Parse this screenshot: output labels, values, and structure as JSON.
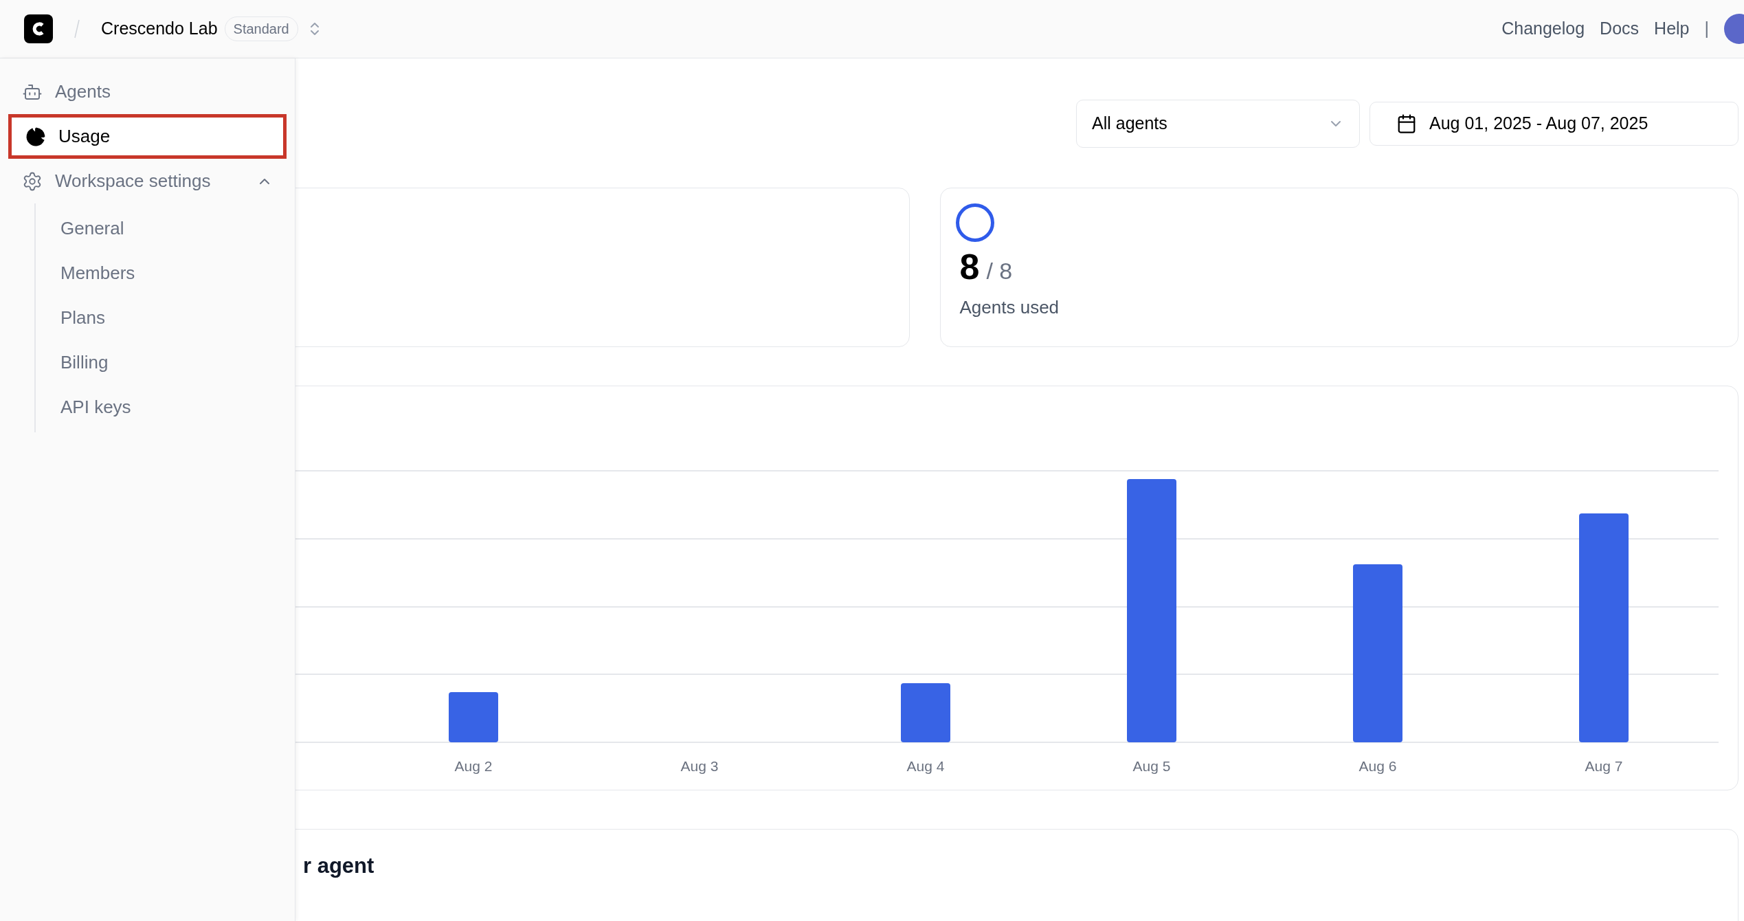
{
  "header": {
    "workspace": "Crescendo Lab",
    "plan_badge": "Standard",
    "links": [
      "Changelog",
      "Docs",
      "Help"
    ],
    "separator": "|"
  },
  "sidebar": {
    "items": [
      {
        "label": "Agents",
        "kind": "agents",
        "selected": false
      },
      {
        "label": "Usage",
        "kind": "usage",
        "selected": true
      },
      {
        "label": "Workspace settings",
        "kind": "settings",
        "selected": false,
        "expanded": true,
        "children": [
          {
            "label": "General"
          },
          {
            "label": "Members"
          },
          {
            "label": "Plans"
          },
          {
            "label": "Billing"
          },
          {
            "label": "API keys"
          }
        ]
      }
    ]
  },
  "filters": {
    "agent_select": "All agents",
    "date_range": "Aug 01, 2025 - Aug 07, 2025"
  },
  "stats": [
    {
      "kind": "empty"
    },
    {
      "kind": "agents",
      "value": "8",
      "total": "/ 8",
      "label": "Agents used"
    }
  ],
  "chart": {
    "x_labels": [
      "Aug 2",
      "Aug 3",
      "Aug 4",
      "Aug 5",
      "Aug 6",
      "Aug 7"
    ]
  },
  "bottom_card": {
    "title": "r agent"
  }
}
